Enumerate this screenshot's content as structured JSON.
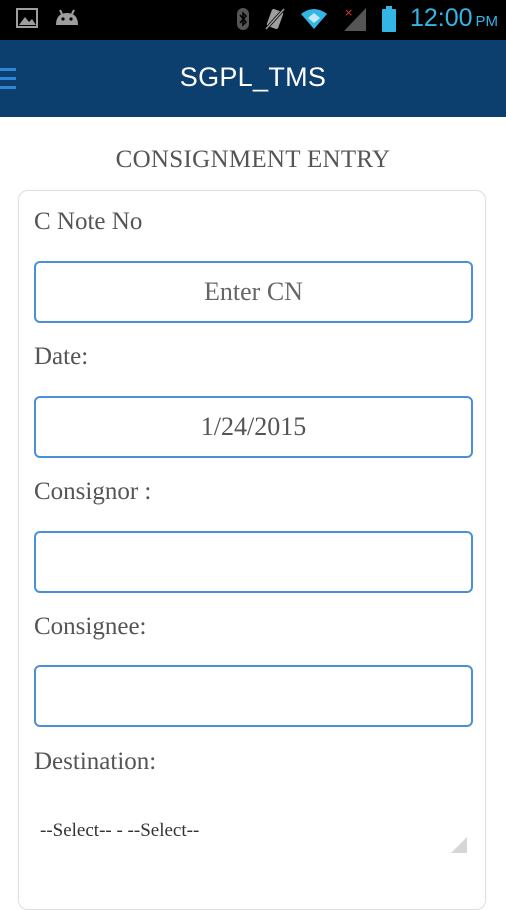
{
  "status_bar": {
    "time": "12:00",
    "ampm": "PM",
    "icons": [
      "image-icon",
      "android-icon",
      "bluetooth-icon",
      "vibrate-off-icon",
      "wifi-icon",
      "signal-icon",
      "battery-icon"
    ]
  },
  "app_bar": {
    "title": "SGPL_TMS",
    "menu_icon": "menu-icon",
    "color": "#0c3f6e"
  },
  "page": {
    "title": "CONSIGNMENT ENTRY"
  },
  "form": {
    "cnote": {
      "label": "C Note No",
      "placeholder": "Enter CN",
      "value": ""
    },
    "date": {
      "label": "Date:",
      "value": "1/24/2015"
    },
    "consignor": {
      "label": "Consignor :",
      "value": ""
    },
    "consignee": {
      "label": "Consignee:",
      "value": ""
    },
    "destination": {
      "label": "Destination:",
      "selected": "--Select-- - --Select--"
    }
  },
  "colors": {
    "accent": "#33b5e5",
    "field_border": "#4a90d9",
    "text": "#555555"
  }
}
